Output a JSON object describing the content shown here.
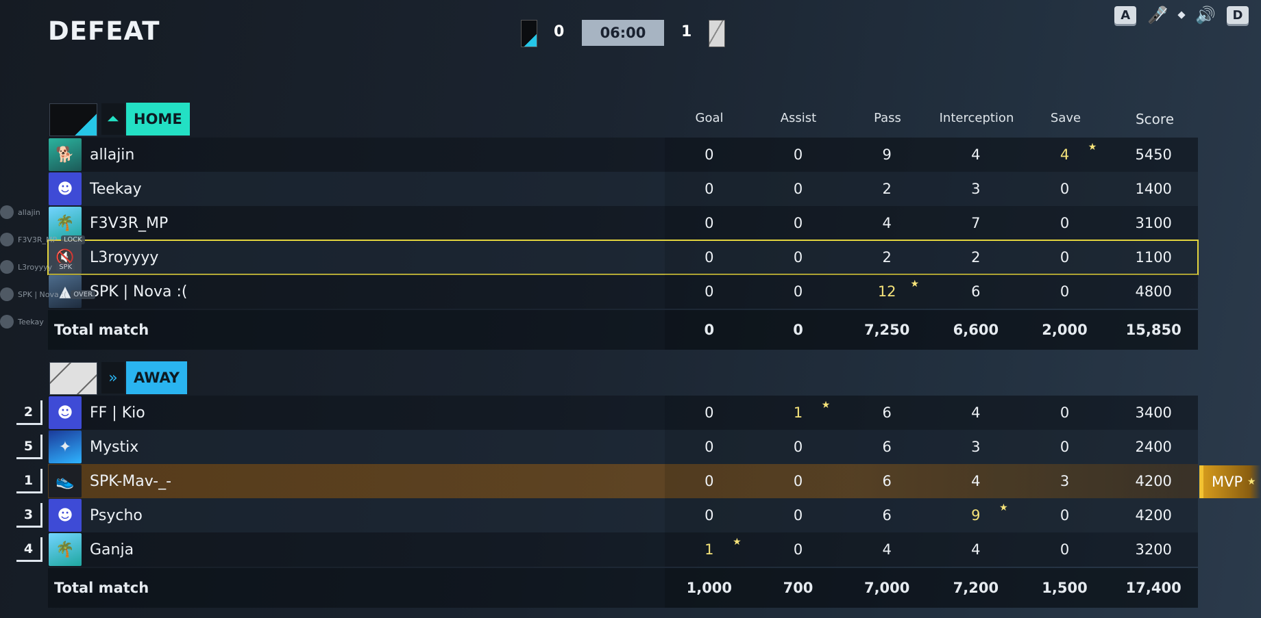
{
  "header": {
    "result": "DEFEAT",
    "home_score": "0",
    "away_score": "1",
    "timer": "06:00",
    "key_left": "A",
    "key_right": "D",
    "icons": [
      "mic-muted-icon",
      "diamond-dot-icon",
      "speaker-icon"
    ]
  },
  "columns": [
    "Goal",
    "Assist",
    "Pass",
    "Interception",
    "Save",
    "Score"
  ],
  "home": {
    "label": "HOME",
    "accent": "#23e0c4",
    "players": [
      {
        "name": "allajin",
        "avatar": "shiba-dog-avatar",
        "stats": [
          "0",
          "0",
          "9",
          "4",
          "4",
          "5450"
        ],
        "highlight": 4
      },
      {
        "name": "Teekay",
        "avatar": "discord-avatar",
        "stats": [
          "0",
          "0",
          "2",
          "3",
          "0",
          "1400"
        ],
        "highlight": -1
      },
      {
        "name": "F3V3R_MP",
        "avatar": "palm-tree-avatar",
        "stats": [
          "0",
          "0",
          "4",
          "7",
          "0",
          "3100"
        ],
        "highlight": -1
      },
      {
        "name": "L3royyyy",
        "avatar": "muted-avatar",
        "stats": [
          "0",
          "0",
          "2",
          "2",
          "0",
          "1100"
        ],
        "highlight": -1
      },
      {
        "name": "SPK | Nova :(",
        "avatar": "photo-avatar",
        "stats": [
          "0",
          "0",
          "12",
          "6",
          "0",
          "4800"
        ],
        "highlight": 2
      }
    ],
    "total_label": "Total match",
    "totals": [
      "0",
      "0",
      "7,250",
      "6,600",
      "2,000",
      "15,850"
    ]
  },
  "away": {
    "label": "AWAY",
    "accent": "#2ab4f0",
    "players": [
      {
        "rank": "2",
        "name": "FF | Kio",
        "avatar": "discord-avatar",
        "stats": [
          "0",
          "1",
          "6",
          "4",
          "0",
          "3400"
        ],
        "highlight": 1
      },
      {
        "rank": "5",
        "name": "Mystix",
        "avatar": "blue-abstract-avatar",
        "stats": [
          "0",
          "0",
          "6",
          "3",
          "0",
          "2400"
        ],
        "highlight": -1
      },
      {
        "rank": "1",
        "name": "SPK-Mav-_-",
        "avatar": "boot-avatar",
        "stats": [
          "0",
          "0",
          "6",
          "4",
          "3",
          "4200"
        ],
        "highlight": -1
      },
      {
        "rank": "3",
        "name": "Psycho",
        "avatar": "discord-avatar",
        "stats": [
          "0",
          "0",
          "6",
          "9",
          "0",
          "4200"
        ],
        "highlight": 3
      },
      {
        "rank": "4",
        "name": "Ganja",
        "avatar": "palm-tree-avatar",
        "stats": [
          "1",
          "0",
          "4",
          "4",
          "0",
          "3200"
        ],
        "highlight": 0
      }
    ],
    "total_label": "Total match",
    "totals": [
      "1,000",
      "700",
      "7,000",
      "7,200",
      "1,500",
      "17,400"
    ]
  },
  "mvp_label": "MVP",
  "overlay": {
    "names": [
      "allajin",
      "F3V3R_MP",
      "L3royyyy",
      "SPK | Nova :(",
      "Teekay"
    ],
    "tags": [
      "LOCK",
      "SPK",
      "OVER"
    ]
  }
}
